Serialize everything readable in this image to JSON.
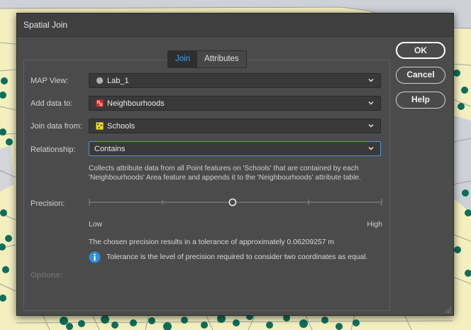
{
  "dialog": {
    "title": "Spatial Join"
  },
  "tabs": [
    {
      "label": "Join",
      "active": true
    },
    {
      "label": "Attributes",
      "active": false
    }
  ],
  "fields": {
    "map_view": {
      "label": "MAP View:",
      "value": "Lab_1",
      "icon": "globe-icon"
    },
    "add_data_to": {
      "label": "Add data to:",
      "value": "Neighbourhoods",
      "icon": "polygon-layer-icon"
    },
    "join_data_from": {
      "label": "Join data from:",
      "value": "Schools",
      "icon": "point-layer-icon"
    },
    "relationship": {
      "label": "Relationship:",
      "value": "Contains"
    }
  },
  "relationship_description": "Collects attribute data from all Point features on 'Schools' that are contained by each 'Neighbourhoods' Area feature and appends it to the 'Neighbourhoods' attribute table.",
  "precision": {
    "label": "Precision:",
    "low_label": "Low",
    "high_label": "High",
    "level_fraction": 0.49,
    "tolerance_text": "The chosen precision results in a tolerance of approximately 0.06209257 m",
    "info_text": "Tolerance is the level of precision required to consider two coordinates as equal."
  },
  "options_label": "Options:",
  "buttons": {
    "ok": "OK",
    "cancel": "Cancel",
    "help": "Help"
  },
  "colors": {
    "accent": "#3ea6f5",
    "map_land": "#f3efbf",
    "map_points": "#0d6e5a",
    "dialog_bg": "#4b4b4b"
  }
}
